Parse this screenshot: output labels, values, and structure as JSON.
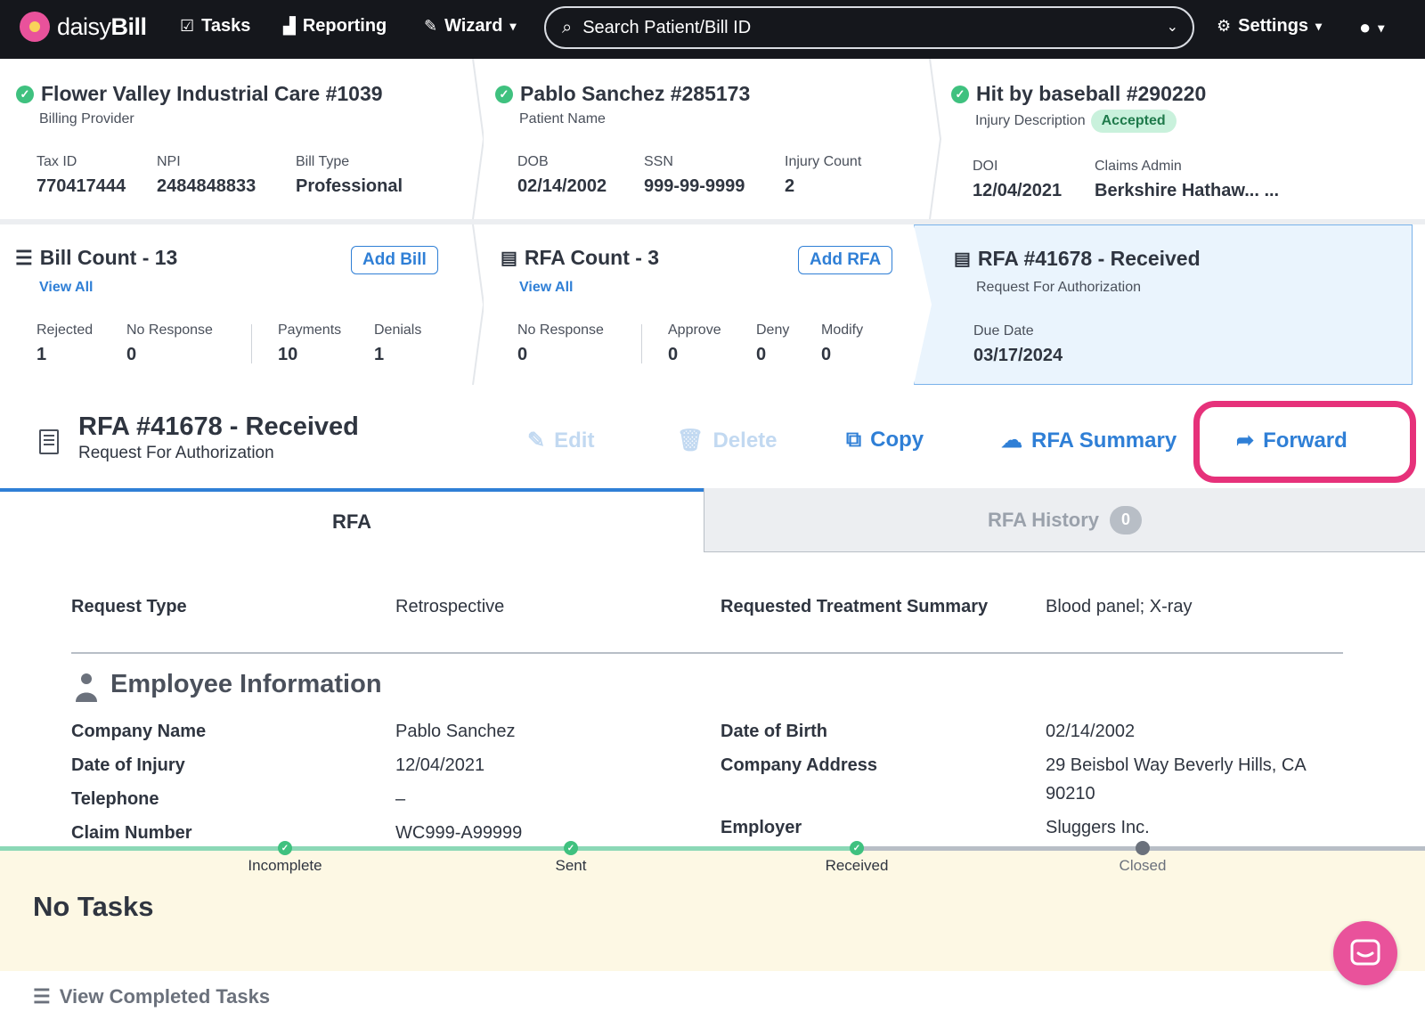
{
  "nav": {
    "brand_light": "daisy",
    "brand_bold": "Bill",
    "tasks": "Tasks",
    "reporting": "Reporting",
    "wizard": "Wizard",
    "search_placeholder": "Search Patient/Bill ID",
    "settings": "Settings"
  },
  "provider": {
    "title": "Flower Valley Industrial Care #1039",
    "subtitle": "Billing Provider",
    "tax_id_label": "Tax ID",
    "tax_id": "770417444",
    "npi_label": "NPI",
    "npi": "2484848833",
    "bill_type_label": "Bill Type",
    "bill_type": "Professional"
  },
  "patient": {
    "title": "Pablo Sanchez #285173",
    "subtitle": "Patient Name",
    "dob_label": "DOB",
    "dob": "02/14/2002",
    "ssn_label": "SSN",
    "ssn": "999-99-9999",
    "injury_count_label": "Injury Count",
    "injury_count": "2"
  },
  "injury": {
    "title": "Hit by baseball #290220",
    "subtitle": "Injury Description",
    "status": "Accepted",
    "doi_label": "DOI",
    "doi": "12/04/2021",
    "claims_admin_label": "Claims Admin",
    "claims_admin": "Berkshire Hathaw... ..."
  },
  "bills": {
    "title": "Bill Count - 13",
    "add_label": "Add Bill",
    "view_all": "View All",
    "rejected_label": "Rejected",
    "rejected": "1",
    "no_response_label": "No Response",
    "no_response": "0",
    "payments_label": "Payments",
    "payments": "10",
    "denials_label": "Denials",
    "denials": "1"
  },
  "rfas": {
    "title": "RFA Count - 3",
    "add_label": "Add RFA",
    "view_all": "View All",
    "no_response_label": "No Response",
    "no_response": "0",
    "approve_label": "Approve",
    "approve": "0",
    "deny_label": "Deny",
    "deny": "0",
    "modify_label": "Modify",
    "modify": "0"
  },
  "current_rfa": {
    "title": "RFA #41678 - Received",
    "subtitle": "Request For Authorization",
    "due_date_label": "Due Date",
    "due_date": "03/17/2024"
  },
  "actions": {
    "edit": "Edit",
    "delete": "Delete",
    "copy": "Copy",
    "summary": "RFA Summary",
    "forward": "Forward"
  },
  "tabs": {
    "rfa": "RFA",
    "history": "RFA History",
    "history_count": "0"
  },
  "details": {
    "request_type_label": "Request Type",
    "request_type": "Retrospective",
    "treatment_summary_label": "Requested Treatment Summary",
    "treatment_summary": "Blood panel; X-ray"
  },
  "employee": {
    "section_title": "Employee Information",
    "company_name_label": "Company Name",
    "company_name": "Pablo Sanchez",
    "date_of_injury_label": "Date of Injury",
    "date_of_injury": "12/04/2021",
    "telephone_label": "Telephone",
    "telephone": "–",
    "claim_number_label": "Claim Number",
    "claim_number": "WC999-A99999",
    "date_of_birth_label": "Date of Birth",
    "date_of_birth": "02/14/2002",
    "company_address_label": "Company Address",
    "company_address_line1": "29 Beisbol Way Beverly Hills, CA",
    "company_address_line2": "90210",
    "employer_label": "Employer",
    "employer": "Sluggers Inc."
  },
  "progress": {
    "steps": [
      "Incomplete",
      "Sent",
      "Received",
      "Closed"
    ],
    "completed_steps": 3
  },
  "tasks": {
    "title": "No Tasks",
    "view_completed": "View Completed Tasks"
  },
  "colors": {
    "nav_bg": "#15171c",
    "accent_blue": "#2f7fd6",
    "success_green": "#3fc17f",
    "highlight_pink": "#e6317a",
    "tasks_bg": "#fdf8e4"
  }
}
